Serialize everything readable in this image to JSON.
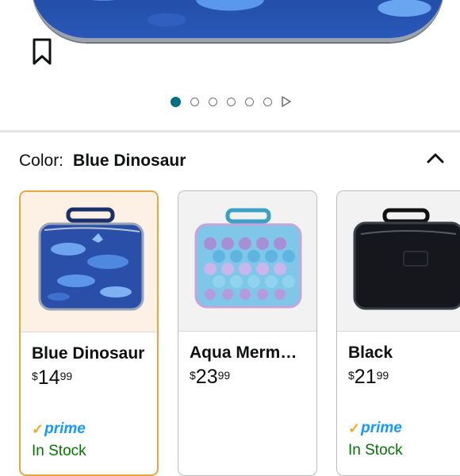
{
  "gallery": {
    "save_icon": "bookmark-icon",
    "total_images": 6,
    "active_index": 0,
    "play_icon": "play-icon"
  },
  "color_selector": {
    "label": "Color:",
    "selected": "Blue Dinosaur",
    "toggle_icon": "chevron-up-icon"
  },
  "swatches": [
    {
      "name": "Blue Dinosaur",
      "price_symbol": "$",
      "price_whole": "14",
      "price_cents": "99",
      "prime": "prime",
      "availability": "In Stock",
      "selected": true
    },
    {
      "name": "Aqua Merm…",
      "price_symbol": "$",
      "price_whole": "23",
      "price_cents": "99",
      "prime": "",
      "availability": "",
      "selected": false
    },
    {
      "name": "Black",
      "price_symbol": "$",
      "price_whole": "21",
      "price_cents": "99",
      "prime": "prime",
      "availability": "In Stock",
      "selected": false
    }
  ],
  "colors": {
    "accent_teal": "#007185",
    "selected_border": "#e7a73c",
    "prime_blue": "#1399ff",
    "prime_check": "#f7a71d",
    "in_stock_green": "#007600"
  }
}
